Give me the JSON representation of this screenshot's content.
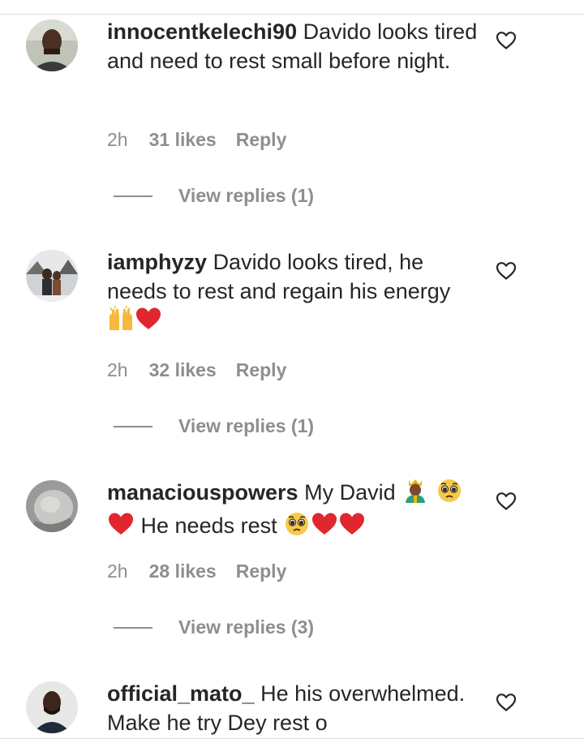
{
  "comments": [
    {
      "username": "innocentkelechi90",
      "text": "Davido looks tired and need to rest small before night.",
      "time": "2h",
      "likes": "31 likes",
      "reply": "Reply",
      "view_replies": "View replies (1)"
    },
    {
      "username": "iamphyzy",
      "text": "Davido looks tired, he needs to rest and regain his energy",
      "emojis": [
        "raising-hands",
        "red-heart"
      ],
      "time": "2h",
      "likes": "32 likes",
      "reply": "Reply",
      "view_replies": "View replies (1)"
    },
    {
      "username": "manaciouspowers",
      "text": "My David",
      "text_after": "He needs rest",
      "emojis": [
        "prince",
        "pleading-face",
        "red-heart",
        "pleading-face",
        "red-heart",
        "red-heart"
      ],
      "time": "2h",
      "likes": "28 likes",
      "reply": "Reply",
      "view_replies": "View replies (3)"
    },
    {
      "username": "official_mato_",
      "text": "He his overwhelmed. Make he try Dey rest o"
    }
  ],
  "icons": {
    "like": "heart-outline-icon"
  },
  "colors": {
    "text": "#262626",
    "secondary": "#8e8e8e",
    "divider": "#dbdbdb",
    "heart_emoji": "#e0262e"
  }
}
